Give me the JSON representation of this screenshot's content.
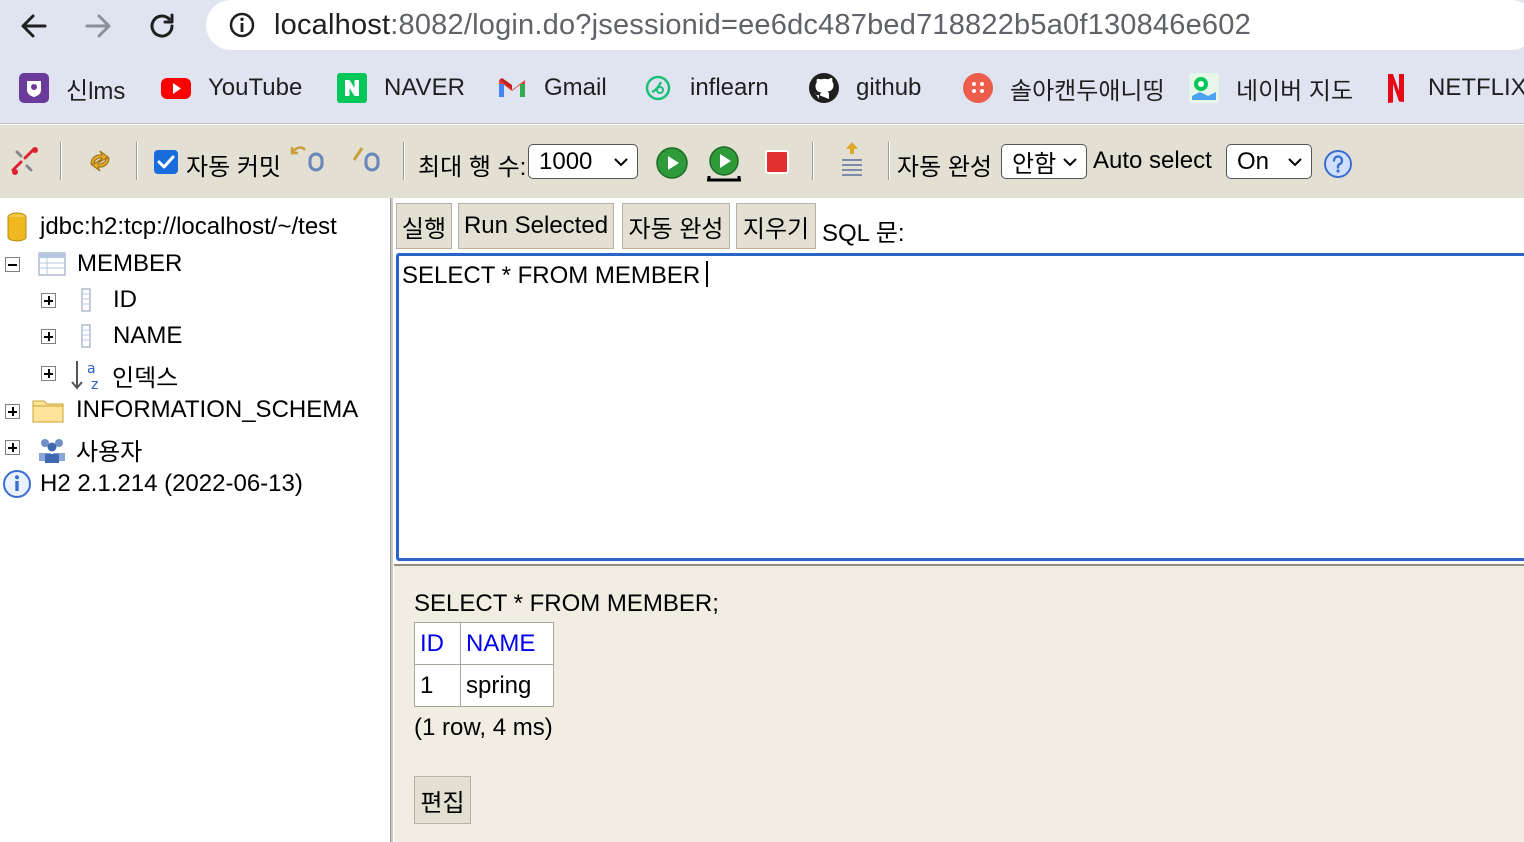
{
  "browser": {
    "url_host": "localhost",
    "url_path": ":8082/login.do?jsessionid=ee6dc487bed718822b5a0f130846e602",
    "bookmarks": [
      {
        "label": "신lms",
        "icon": "lms-icon"
      },
      {
        "label": "YouTube",
        "icon": "youtube-icon"
      },
      {
        "label": "NAVER",
        "icon": "naver-icon"
      },
      {
        "label": "Gmail",
        "icon": "gmail-icon"
      },
      {
        "label": "inflearn",
        "icon": "inflearn-icon"
      },
      {
        "label": "github",
        "icon": "github-icon"
      },
      {
        "label": "솔아캔두애니띵",
        "icon": "dots-icon"
      },
      {
        "label": "네이버 지도",
        "icon": "naver-map-icon"
      },
      {
        "label": "NETFLIX",
        "icon": "netflix-icon"
      }
    ]
  },
  "toolbar": {
    "auto_commit_label": "자동 커밋",
    "auto_commit_checked": true,
    "max_rows_label": "최대 행 수:",
    "max_rows_value": "1000",
    "autocomplete_label": "자동 완성",
    "autocomplete_value": "안함",
    "auto_select_label": "Auto select",
    "auto_select_value": "On"
  },
  "tree": {
    "connection": "jdbc:h2:tcp://localhost/~/test",
    "table": "MEMBER",
    "columns": [
      "ID",
      "NAME"
    ],
    "indexes": "인덱스",
    "schema": "INFORMATION_SCHEMA",
    "users": "사용자",
    "version": "H2 2.1.214 (2022-06-13)"
  },
  "editor": {
    "run_label": "실행",
    "run_selected_label": "Run Selected",
    "autocomplete_label": "자동 완성",
    "clear_label": "지우기",
    "sql_label": "SQL 문:",
    "sql_text": "SELECT * FROM MEMBER"
  },
  "result": {
    "statement": "SELECT * FROM MEMBER;",
    "headers": [
      "ID",
      "NAME"
    ],
    "rows": [
      [
        "1",
        "spring"
      ]
    ],
    "stats": "(1 row, 4 ms)",
    "edit_label": "편집"
  },
  "colors": {
    "accent": "#2b65c8",
    "toolbar_bg": "#e3dfd3",
    "result_bg": "#f1ede2",
    "link_blue": "#0000ee"
  }
}
